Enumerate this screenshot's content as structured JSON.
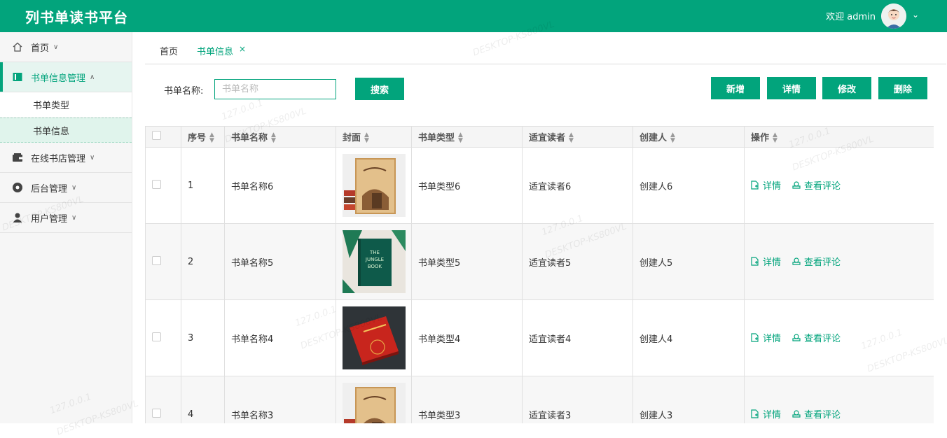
{
  "app": {
    "title": "列书单读书平台",
    "welcome": "欢迎 admin"
  },
  "sidebar": {
    "items": [
      {
        "label": "首页",
        "icon": "home-icon"
      },
      {
        "label": "书单信息管理",
        "icon": "book-icon",
        "expanded": true,
        "children": [
          {
            "label": "书单类型"
          },
          {
            "label": "书单信息"
          }
        ]
      },
      {
        "label": "在线书店管理",
        "icon": "wallet-icon"
      },
      {
        "label": "后台管理",
        "icon": "settings-icon"
      },
      {
        "label": "用户管理",
        "icon": "user-icon"
      }
    ]
  },
  "tabs": {
    "home": "首页",
    "current": "书单信息",
    "close": "×"
  },
  "search": {
    "label": "书单名称:",
    "placeholder": "书单名称",
    "button": "搜索"
  },
  "toolbar": {
    "add": "新增",
    "detail": "详情",
    "edit": "修改",
    "delete": "删除"
  },
  "table": {
    "headers": [
      "序号",
      "书单名称",
      "封面",
      "书单类型",
      "适宜读者",
      "创建人",
      "操作"
    ],
    "rows": [
      {
        "idx": "1",
        "name": "书单名称6",
        "type": "书单类型6",
        "reader": "适宜读者6",
        "creator": "创建人6",
        "cover": "old-book"
      },
      {
        "idx": "2",
        "name": "书单名称5",
        "type": "书单类型5",
        "reader": "适宜读者5",
        "creator": "创建人5",
        "cover": "green-book"
      },
      {
        "idx": "3",
        "name": "书单名称4",
        "type": "书单类型4",
        "reader": "适宜读者4",
        "creator": "创建人4",
        "cover": "red-book"
      },
      {
        "idx": "4",
        "name": "书单名称3",
        "type": "书单类型3",
        "reader": "适宜读者3",
        "creator": "创建人3",
        "cover": "old-book"
      }
    ],
    "ops": {
      "detail": "详情",
      "comments": "查看评论"
    }
  },
  "watermark": [
    "DESKTOP-KS800VL",
    "127.0.0.1"
  ],
  "colors": {
    "accent": "#02a47c"
  }
}
